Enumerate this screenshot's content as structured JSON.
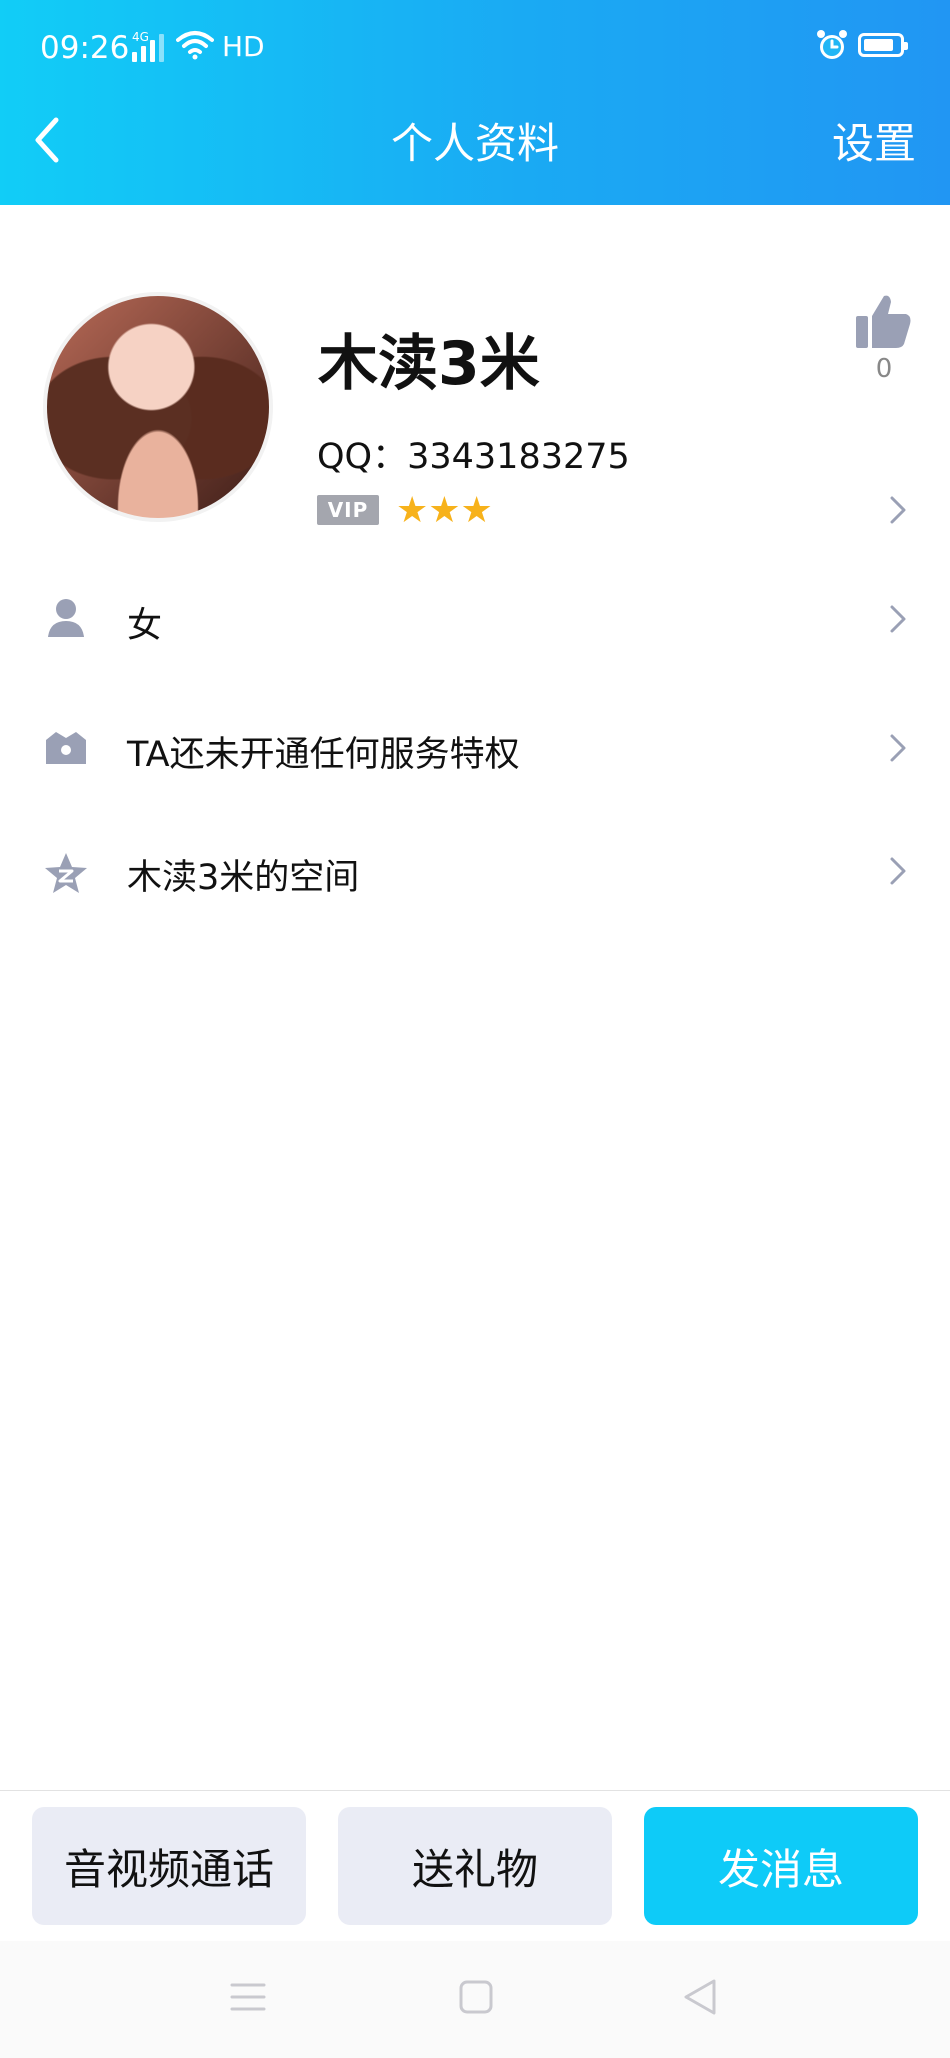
{
  "status_bar": {
    "time": "09:26",
    "network_tag": "4G",
    "hd": "HD"
  },
  "nav": {
    "title": "个人资料",
    "settings": "设置"
  },
  "profile": {
    "nickname": "木渎3米",
    "qq": "QQ：3343183275",
    "vip_label": "VIP",
    "stars": "★★★",
    "like_count": "0"
  },
  "list": {
    "gender": "女",
    "service": "TA还未开通任何服务特权",
    "zone": "木渎3米的空间"
  },
  "actions": {
    "call": "音视频通话",
    "gift": "送礼物",
    "message": "发消息"
  },
  "colors": {
    "header_start": "#11cdf7",
    "header_end": "#2196f3",
    "accent_button": "#0ecbf8",
    "secondary_button": "#eaecf5",
    "icon_grey": "#9aa0b5"
  }
}
